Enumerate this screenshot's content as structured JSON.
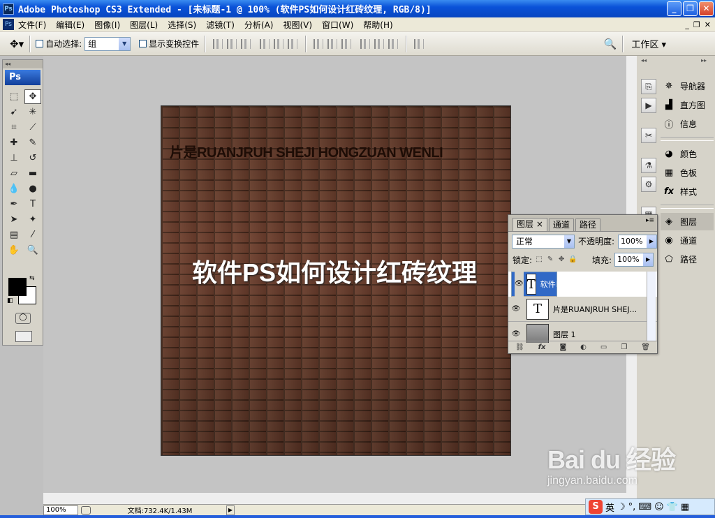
{
  "window": {
    "title": "Adobe Photoshop CS3 Extended - [未标题-1 @ 100% (软件PS如何设计红砖纹理, RGB/8)]",
    "app_icon": "Ps"
  },
  "menu": [
    "文件(F)",
    "编辑(E)",
    "图像(I)",
    "图层(L)",
    "选择(S)",
    "滤镜(T)",
    "分析(A)",
    "视图(V)",
    "窗口(W)",
    "帮助(H)"
  ],
  "options": {
    "auto_select_label": "自动选择:",
    "auto_select_value": "组",
    "show_transform_label": "显示变换控件",
    "workspace_label": "工作区 ▾"
  },
  "toolbox": {
    "logo": "Ps"
  },
  "canvas": {
    "small_text": "片是RUANJRUH SHEJI HONGZUAN WENLI",
    "big_text": "软件PS如何设计红砖纹理",
    "brick_color": "#6a3d2c",
    "mortar_color": "#402418"
  },
  "status": {
    "zoom": "100%",
    "doc_info": "文档:732.4K/1.43M"
  },
  "dock": {
    "items": [
      {
        "label": "导航器",
        "icon": "navigator-icon"
      },
      {
        "label": "直方图",
        "icon": "histogram-icon"
      },
      {
        "label": "信息",
        "icon": "info-icon"
      },
      {
        "label": "颜色",
        "icon": "color-icon"
      },
      {
        "label": "色板",
        "icon": "swatches-icon"
      },
      {
        "label": "样式",
        "icon": "styles-icon"
      },
      {
        "label": "图层",
        "icon": "layers-icon"
      },
      {
        "label": "通道",
        "icon": "channels-icon"
      },
      {
        "label": "路径",
        "icon": "paths-icon"
      }
    ]
  },
  "layers_panel": {
    "tabs": [
      "图层",
      "通道",
      "路径"
    ],
    "blend_mode": "正常",
    "opacity_label": "不透明度:",
    "opacity_value": "100%",
    "lock_label": "锁定:",
    "fill_label": "填充:",
    "fill_value": "100%",
    "layers": [
      {
        "name": "软件PS如何设计红...",
        "thumb": "T",
        "selected": true
      },
      {
        "name": "片是RUANJRUH SHEJ...",
        "thumb": "T",
        "selected": false
      },
      {
        "name": "图层 1",
        "thumb": "",
        "selected": false
      }
    ]
  },
  "tray": {
    "ime": "英"
  },
  "watermark": {
    "line1": "Bai du 经验",
    "line2": "jingyan.baidu.com"
  }
}
